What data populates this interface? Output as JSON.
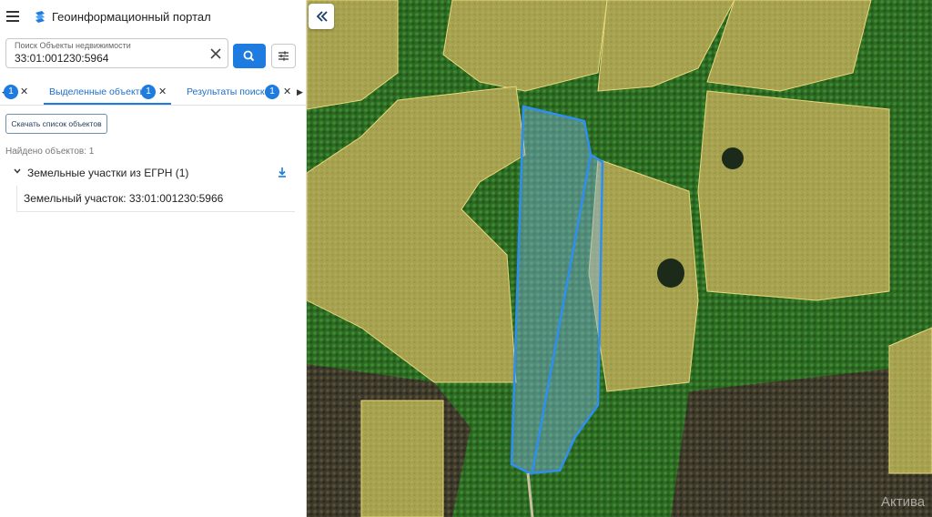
{
  "app": {
    "title": "Геоинформационный портал",
    "menu_icon": "hamburger-menu-icon",
    "logo_icon": "portal-logo-icon"
  },
  "search": {
    "label": "Поиск Объекты недвижимости",
    "value": "33:01:001230:5964",
    "clear_icon": "close-icon",
    "search_icon": "search-icon",
    "filter_icon": "tune-sliders-icon"
  },
  "tabs": {
    "items": [
      {
        "label": "Выделенные объекты",
        "badge": "1",
        "active": true
      },
      {
        "label": "Результаты поиска",
        "badge": "1",
        "active": false
      }
    ],
    "left_partial_badge": "1"
  },
  "actions": {
    "download_list": "Скачать список объектов"
  },
  "results": {
    "found": "Найдено объектов: 1",
    "group": {
      "title": "Земельные участки из ЕГРН (1)",
      "items": [
        {
          "label": "Земельный участок: 33:01:001230:5966"
        }
      ]
    }
  },
  "map": {
    "watermark": "Актива",
    "colors": {
      "parcel_outline": "#2f8ff0",
      "parcel_fill": "#7fb4e0",
      "field_overlay": "#e8d87a",
      "forest": "#1f5a1c"
    }
  },
  "accent": "#1e7be0"
}
